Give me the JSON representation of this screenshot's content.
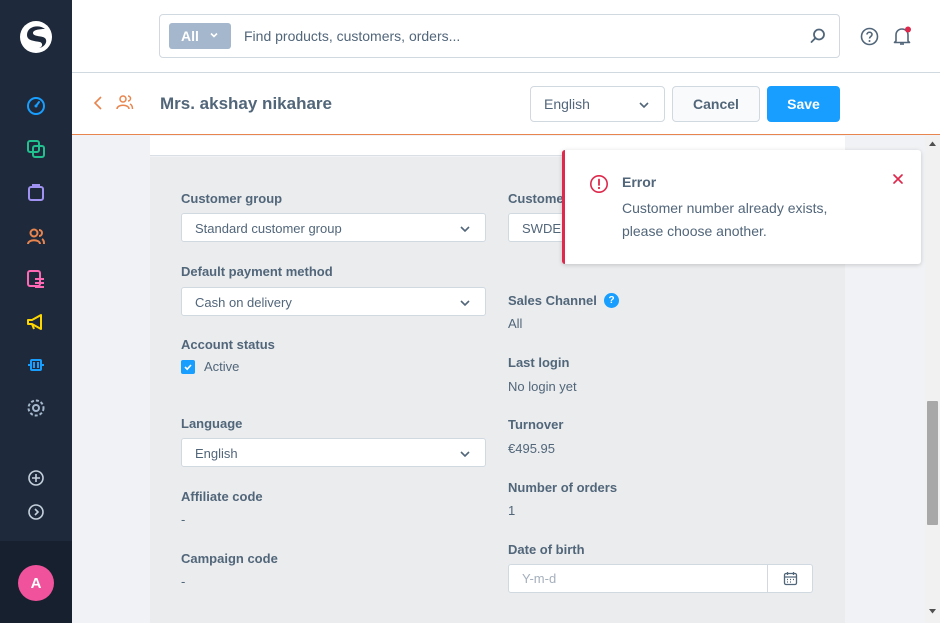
{
  "sidebar": {
    "icons": [
      "dashboard-icon",
      "catalogue-icon",
      "orders-icon",
      "customers-icon",
      "content-icon",
      "marketing-icon",
      "extensions-icon",
      "settings-icon",
      "add-icon",
      "expand-icon"
    ],
    "avatar_initial": "A"
  },
  "search": {
    "type_label": "All",
    "placeholder": "Find products, customers, orders..."
  },
  "smartbar": {
    "title": "Mrs. akshay nikahare",
    "language": "English",
    "cancel_label": "Cancel",
    "save_label": "Save"
  },
  "form": {
    "customer_group": {
      "label": "Customer group",
      "value": "Standard customer group"
    },
    "customer_number": {
      "label": "Custome",
      "value": "SWDE"
    },
    "payment_method": {
      "label": "Default payment method",
      "value": "Cash on delivery"
    },
    "sales_channel": {
      "label": "Sales Channel",
      "help": "?",
      "value": "All"
    },
    "account_status": {
      "label": "Account status",
      "checkbox_label": "Active",
      "checked": true
    },
    "last_login": {
      "label": "Last login",
      "value": "No login yet"
    },
    "turnover": {
      "label": "Turnover",
      "value": "€495.95"
    },
    "language": {
      "label": "Language",
      "value": "English"
    },
    "affiliate_code": {
      "label": "Affiliate code",
      "value": "-"
    },
    "number_of_orders": {
      "label": "Number of orders",
      "value": "1"
    },
    "campaign_code": {
      "label": "Campaign code",
      "value": "-"
    },
    "date_of_birth": {
      "label": "Date of birth",
      "placeholder": "Y-m-d"
    }
  },
  "toast": {
    "title": "Error",
    "message": "Customer number already exists, please choose another."
  },
  "colors": {
    "sidebar": "#1e2a3b",
    "primary": "#189eff",
    "error": "#de294c",
    "accent_orange": "#e8844e",
    "avatar": "#f0529c"
  }
}
